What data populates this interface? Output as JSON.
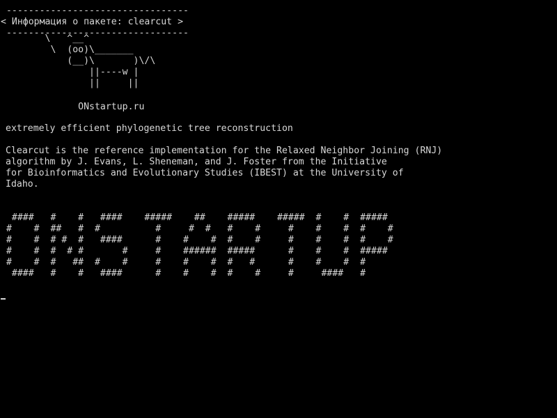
{
  "terminal": {
    "colors": {
      "background": "#000000",
      "foreground": "#d8d8d8"
    },
    "cowsay": {
      "top_border": " ---------------------------------",
      "message": "< Информация о пакете: clearcut >",
      "bottom_border": " ---------------------------------",
      "cow": [
        "        \\   ^__^",
        "         \\  (oo)\\_______",
        "            (__)\\       )\\/\\",
        "                ||----w |",
        "                ||     ||"
      ]
    },
    "site": "              ONstartup.ru",
    "summary": "extremely efficient phylogenetic tree reconstruction",
    "description": [
      "Clearcut is the reference implementation for the Relaxed Neighbor Joining (RNJ)",
      "algorithm by J. Evans, L. Sheneman, and J. Foster from the Initiative",
      "for Bioinformatics and Evolutionary Studies (IBEST) at the University of",
      "Idaho."
    ],
    "banner": [
      "  ####   #    #   ####    #####    ##    #####    #####  #    #  #####",
      " #    #  ##   #  #          #     #  #   #    #     #    #    #  #    #",
      " #    #  # #  #   ####      #    #    #  #    #     #    #    #  #    #",
      " #    #  #  # #       #     #    ######  #####      #    #    #  #####",
      " #    #  #   ##  #    #     #    #    #  #   #      #    #    #  #",
      "  ####   #    #   ####      #    #    #  #    #     #     ####   #"
    ]
  }
}
